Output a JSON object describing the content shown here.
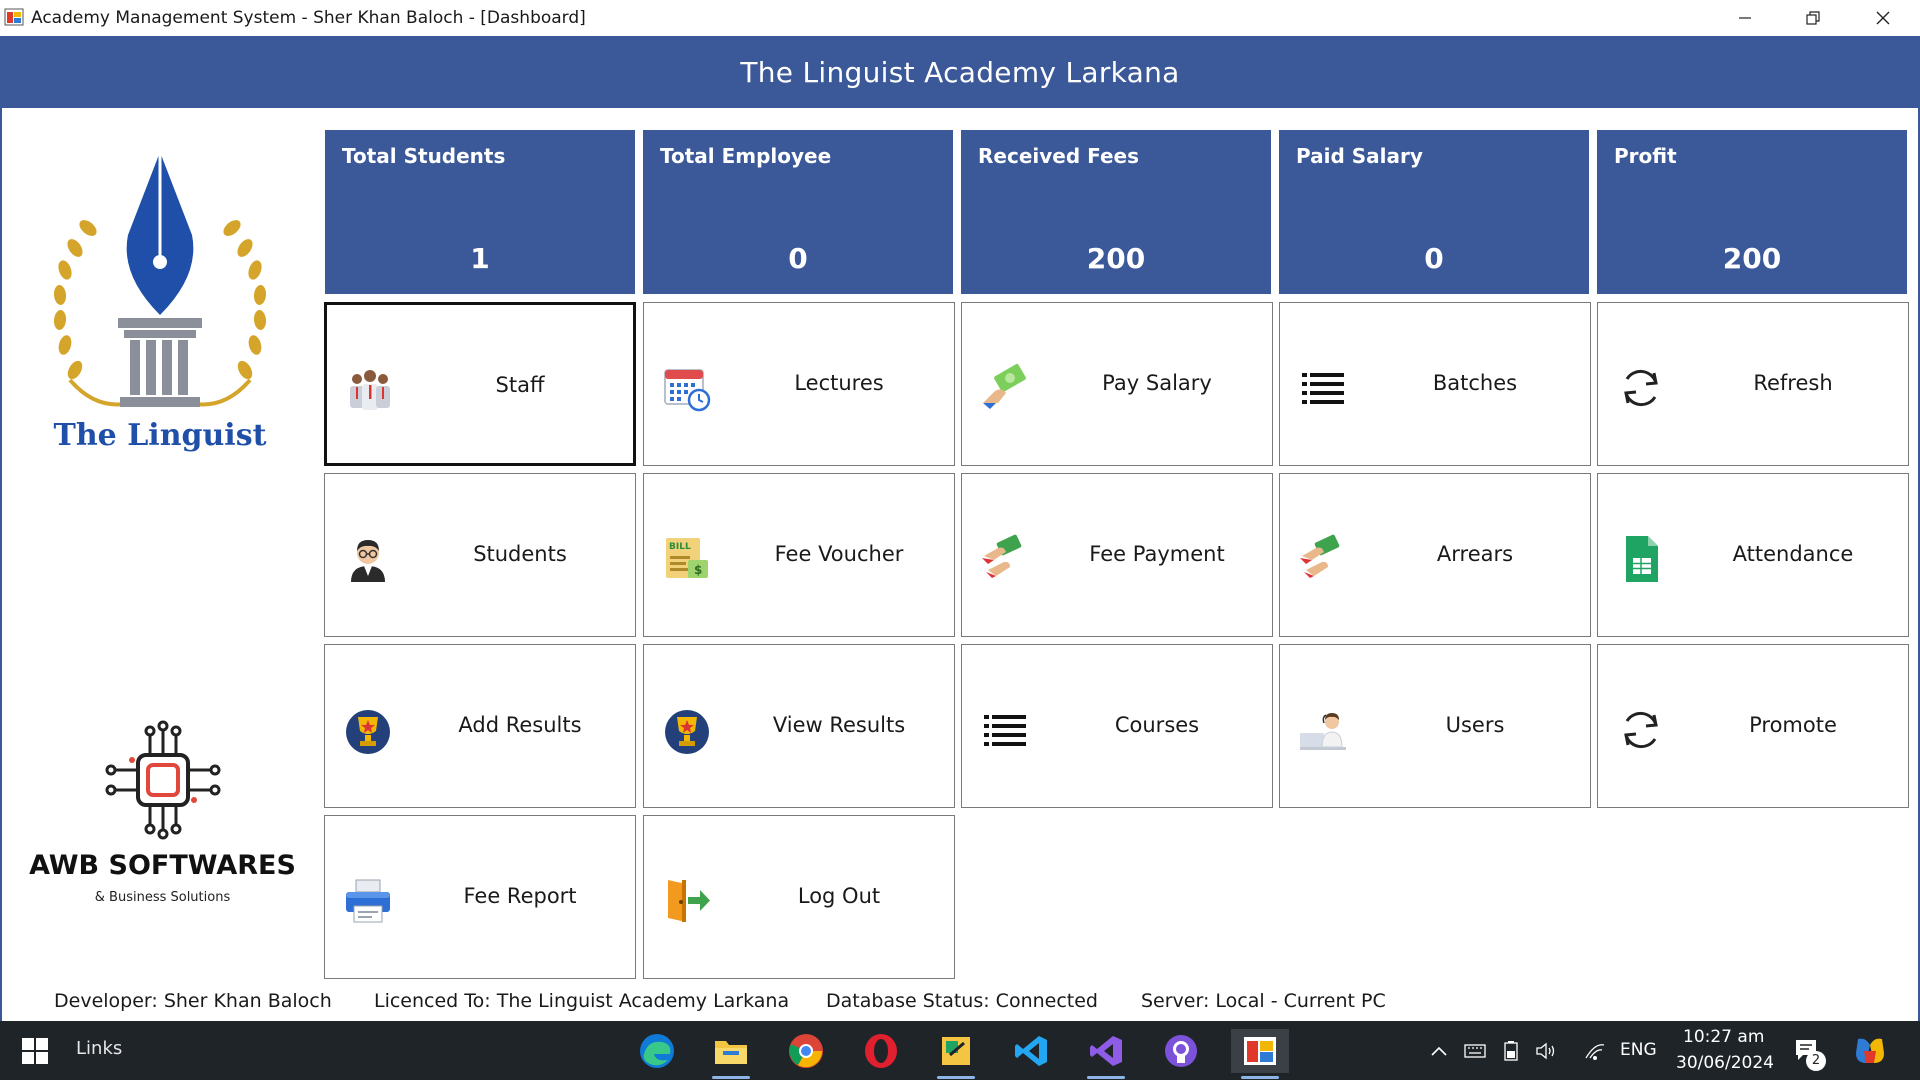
{
  "window": {
    "title": "Academy Management System - Sher Khan Baloch - [Dashboard]"
  },
  "header": {
    "title": "The Linguist Academy Larkana"
  },
  "logos": {
    "top_text": "The Linguist",
    "bottom_name": "AWB SOFTWARES",
    "bottom_tagline": "& Business Solutions"
  },
  "stats": [
    {
      "label": "Total Students",
      "value": "1"
    },
    {
      "label": "Total Employee",
      "value": "0"
    },
    {
      "label": "Received Fees",
      "value": "200"
    },
    {
      "label": "Paid Salary",
      "value": "0"
    },
    {
      "label": "Profit",
      "value": "200"
    }
  ],
  "tiles": [
    {
      "label": "Staff",
      "icon": "staff-icon"
    },
    {
      "label": "Lectures",
      "icon": "calendar-icon"
    },
    {
      "label": "Pay Salary",
      "icon": "money-hand-icon"
    },
    {
      "label": "Batches",
      "icon": "list-icon"
    },
    {
      "label": "Refresh",
      "icon": "refresh-icon"
    },
    {
      "label": "Students",
      "icon": "student-icon"
    },
    {
      "label": "Fee Voucher",
      "icon": "bill-icon"
    },
    {
      "label": "Fee Payment",
      "icon": "payment-hand-icon"
    },
    {
      "label": "Arrears",
      "icon": "payment-hand-icon"
    },
    {
      "label": "Attendance",
      "icon": "spreadsheet-icon"
    },
    {
      "label": "Add Results",
      "icon": "trophy-icon"
    },
    {
      "label": "View Results",
      "icon": "trophy-icon"
    },
    {
      "label": "Courses",
      "icon": "list-icon"
    },
    {
      "label": "Users",
      "icon": "user-desk-icon"
    },
    {
      "label": "Promote",
      "icon": "refresh-icon"
    },
    {
      "label": "Fee Report",
      "icon": "printer-icon"
    },
    {
      "label": "Log Out",
      "icon": "logout-door-icon"
    }
  ],
  "footer": {
    "developer": "Developer: Sher Khan Baloch",
    "licence": "Licenced To: The Linguist Academy Larkana",
    "database": "Database Status: Connected",
    "server": "Server: Local - Current PC"
  },
  "taskbar": {
    "links_label": "Links",
    "language": "ENG",
    "time": "10:27 am",
    "date": "30/06/2024",
    "notification_count": "2"
  },
  "colors": {
    "primary": "#3b5898",
    "taskbar": "#1f2429"
  }
}
